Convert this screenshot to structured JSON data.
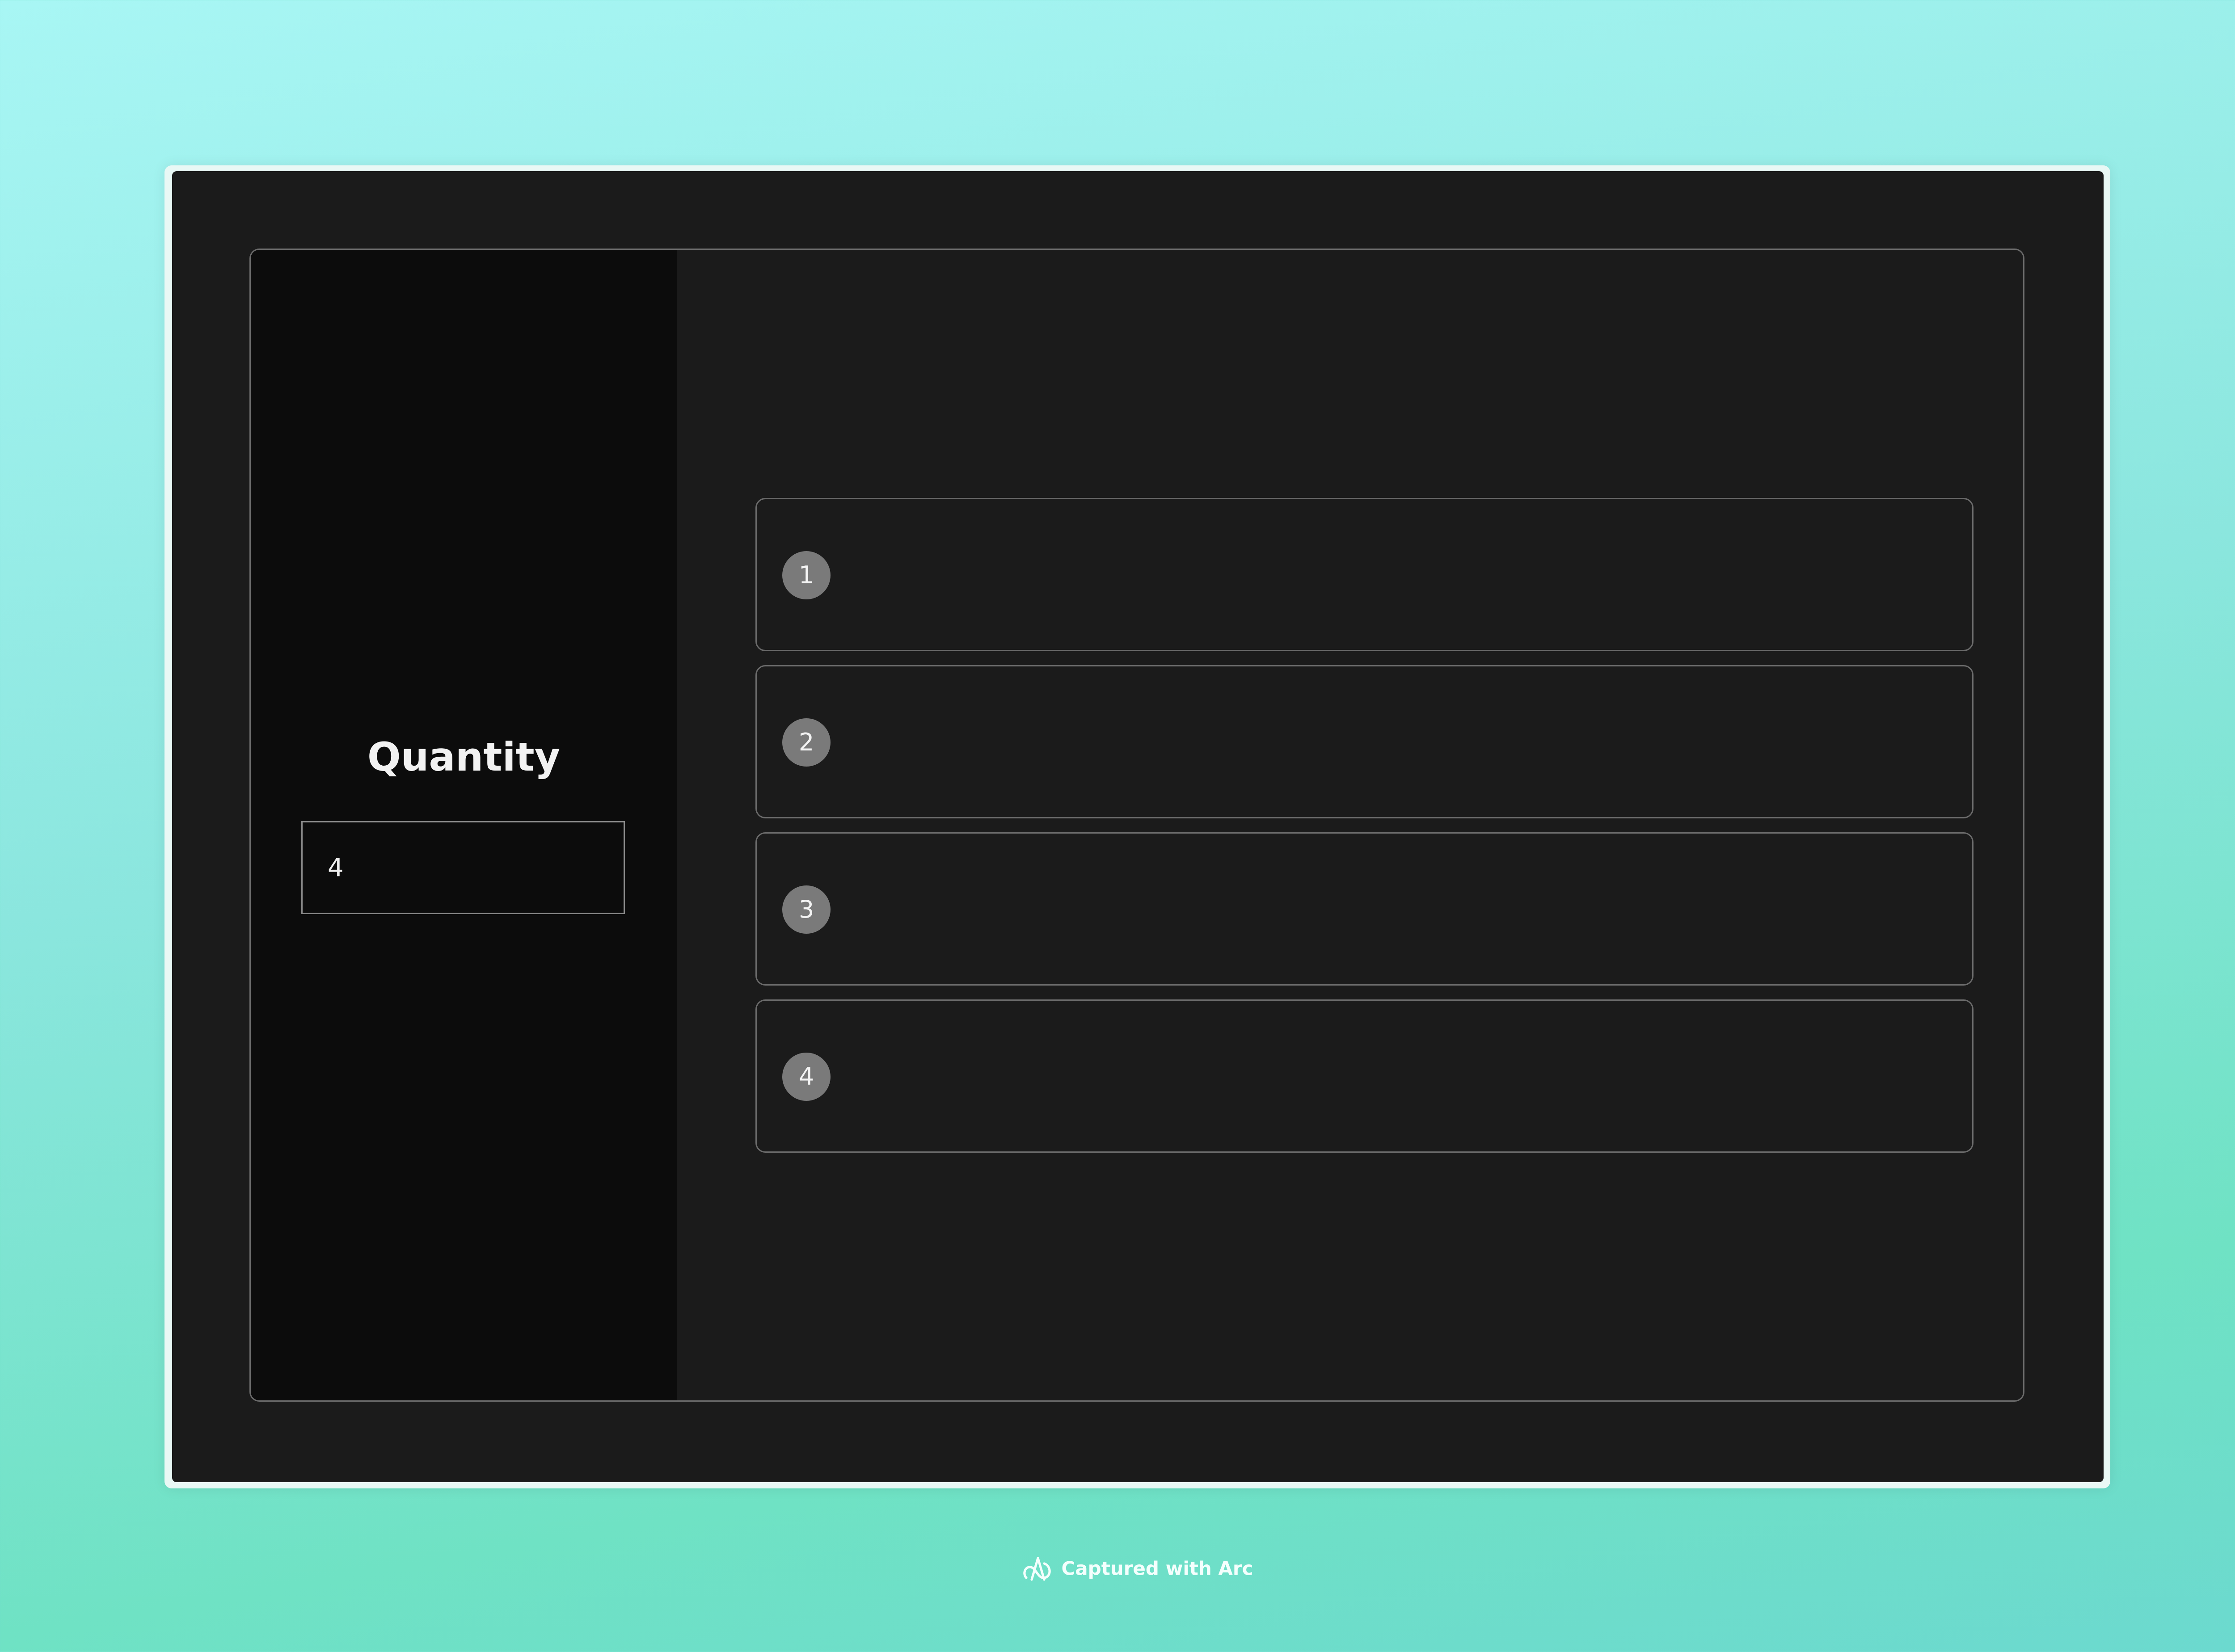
{
  "quantity": {
    "label": "Quantity",
    "value": "4"
  },
  "items": [
    {
      "number": "1"
    },
    {
      "number": "2"
    },
    {
      "number": "3"
    },
    {
      "number": "4"
    }
  ],
  "watermark": {
    "icon": "arc-logo-icon",
    "text": "Captured with Arc"
  },
  "colors": {
    "background_top": "#a8f6f4",
    "background_bottom": "#6fe2c4",
    "window": "#1b1b1b",
    "sidebar": "#0c0c0c",
    "badge": "#7a7a7a",
    "border": "#6a6a6a"
  }
}
